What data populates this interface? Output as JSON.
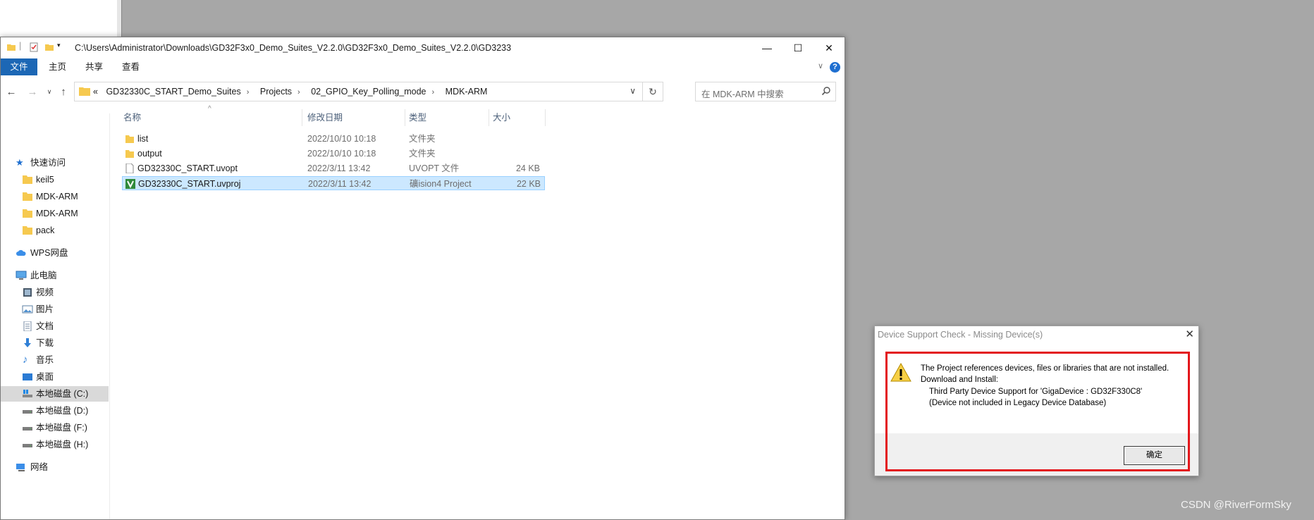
{
  "explorer": {
    "title": "C:\\Users\\Administrator\\Downloads\\GD32F3x0_Demo_Suites_V2.2.0\\GD32F3x0_Demo_Suites_V2.2.0\\GD3233",
    "ribbon_tabs": [
      "文件",
      "主页",
      "共享",
      "查看"
    ],
    "window_buttons": {
      "minimize": "—",
      "maximize": "☐",
      "close": "✕"
    },
    "breadcrumb": {
      "overflow": "«",
      "parts": [
        "GD32330C_START_Demo_Suites",
        "Projects",
        "02_GPIO_Key_Polling_mode",
        "MDK-ARM"
      ]
    },
    "search_placeholder": "在 MDK-ARM 中搜索",
    "columns": [
      "名称",
      "修改日期",
      "类型",
      "大小"
    ],
    "files": [
      {
        "name": "list",
        "date": "2022/10/10 10:18",
        "type": "文件夹",
        "size": "",
        "icon": "folder-icon"
      },
      {
        "name": "output",
        "date": "2022/10/10 10:18",
        "type": "文件夹",
        "size": "",
        "icon": "folder-icon"
      },
      {
        "name": "GD32330C_START.uvopt",
        "date": "2022/3/11 13:42",
        "type": "UVOPT 文件",
        "size": "24 KB",
        "icon": "file-icon"
      },
      {
        "name": "GD32330C_START.uvproj",
        "date": "2022/3/11 13:42",
        "type": "礦ision4 Project",
        "size": "22 KB",
        "icon": "uvision-icon",
        "selected": true
      }
    ],
    "sidebar": {
      "quick_access": "快速访问",
      "quick_items": [
        "keil5",
        "MDK-ARM",
        "MDK-ARM",
        "pack"
      ],
      "wps": "WPS网盘",
      "this_pc": "此电脑",
      "pc_items": [
        "视频",
        "图片",
        "文档",
        "下载",
        "音乐",
        "桌面"
      ],
      "drives": [
        "本地磁盘 (C:)",
        "本地磁盘 (D:)",
        "本地磁盘 (F:)",
        "本地磁盘 (H:)"
      ],
      "network": "网络"
    }
  },
  "dialog": {
    "title": "Device Support Check - Missing Device(s)",
    "message_line1": "The Project references devices, files or libraries that are not installed.",
    "message_line2": "Download and Install:",
    "detail_line1": "Third Party Device Support for 'GigaDevice : GD32F330C8'",
    "detail_line2": "(Device not included in Legacy Device Database)",
    "ok_label": "确定"
  },
  "watermark": "CSDN @RiverFormSky",
  "colors": {
    "accent": "#1c67b5",
    "selection": "#cce8ff",
    "highlight_box": "#e3161b",
    "folder": "#f6c94f"
  }
}
